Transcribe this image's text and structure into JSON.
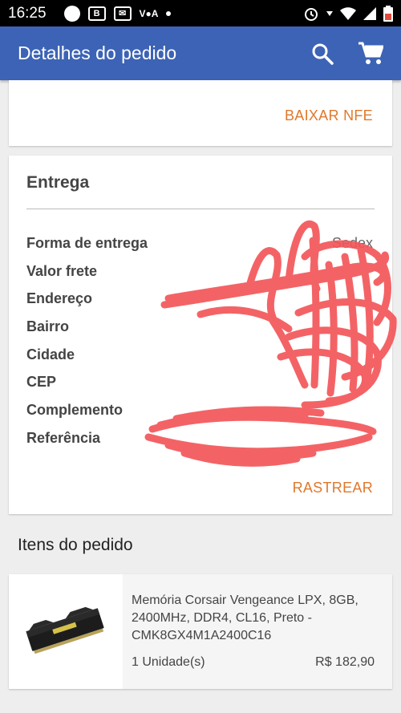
{
  "status_bar": {
    "time": "16:25",
    "carrier_label": "V●A"
  },
  "app_bar": {
    "title": "Detalhes do pedido",
    "icons": [
      "search-icon",
      "cart-icon"
    ],
    "color": "#3c63b5"
  },
  "nfe": {
    "download_label": "BAIXAR NFE"
  },
  "entrega": {
    "title": "Entrega",
    "rows": [
      {
        "label": "Forma de entrega",
        "value": "Sedex"
      },
      {
        "label": "Valor frete",
        "value": ""
      },
      {
        "label": "Endereço",
        "value": ""
      },
      {
        "label": "Bairro",
        "value": ""
      },
      {
        "label": "Cidade",
        "value": ""
      },
      {
        "label": "CEP",
        "value": ""
      },
      {
        "label": "Complemento",
        "value": ""
      },
      {
        "label": "Referência",
        "value": ""
      }
    ],
    "track_label": "RASTREAR",
    "accent": "#e0782b"
  },
  "items": {
    "section_title": "Itens do pedido",
    "list": [
      {
        "name": "Memória Corsair Vengeance LPX, 8GB, 2400MHz, DDR4, CL16, Preto - CMK8GX4M1A2400C16",
        "quantity": "1 Unidade(s)",
        "price": "R$ 182,90",
        "image_icon": "ram-module-icon"
      }
    ]
  }
}
